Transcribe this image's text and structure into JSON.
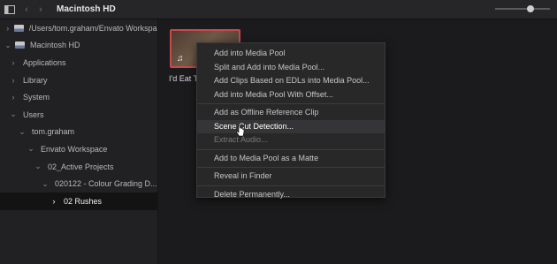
{
  "topbar": {
    "sidebar_toggle_icon": "sidebar-icon",
    "back_glyph": "‹",
    "forward_glyph": "›",
    "title": "Macintosh HD",
    "zoom_level": 0.65
  },
  "sidebar": {
    "items": [
      {
        "label": "/Users/tom.graham/Envato Workspace",
        "chev": "›",
        "icon": "drive-icon"
      },
      {
        "label": "Macintosh HD",
        "chev": "⌄",
        "icon": "drive-icon"
      },
      {
        "label": "Applications",
        "chev": "›"
      },
      {
        "label": "Library",
        "chev": "›"
      },
      {
        "label": "System",
        "chev": "›"
      },
      {
        "label": "Users",
        "chev": "⌄"
      },
      {
        "label": "tom.graham",
        "chev": "⌄"
      },
      {
        "label": "Envato Workspace",
        "chev": "⌄"
      },
      {
        "label": "02_Active Projects",
        "chev": "⌄"
      },
      {
        "label": "020122 - Colour Grading D...",
        "chev": "⌄"
      },
      {
        "label": "02 Rushes",
        "chev": "›",
        "selected": true
      }
    ]
  },
  "clip": {
    "name": "I'd Eat Th",
    "audio_icon": "♫"
  },
  "context_menu": {
    "groups": [
      [
        "Add into Media Pool",
        "Split and Add into Media Pool...",
        "Add Clips Based on EDLs into Media Pool...",
        "Add into Media Pool With Offset..."
      ],
      [
        "Add as Offline Reference Clip",
        "Scene Cut Detection...",
        "Extract Audio..."
      ],
      [
        "Add to Media Pool as a Matte"
      ],
      [
        "Reveal in Finder"
      ],
      [
        "Delete Permanently..."
      ]
    ],
    "highlighted": "Scene Cut Detection...",
    "disabled": [
      "Extract Audio..."
    ]
  },
  "colors": {
    "clip_border": "#c74a4a",
    "menu_bg": "#282829",
    "highlight_bg": "#353537"
  }
}
